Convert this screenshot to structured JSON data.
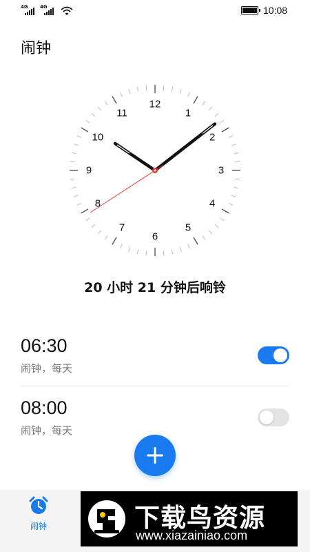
{
  "status_bar": {
    "network_1": "4G",
    "network_2": "4G",
    "time": "10:08",
    "icons": [
      "signal-icon",
      "signal-icon",
      "wifi-icon",
      "battery-icon"
    ]
  },
  "header": {
    "title": "闹钟"
  },
  "clock": {
    "numbers": [
      "12",
      "1",
      "2",
      "3",
      "4",
      "5",
      "6",
      "7",
      "8",
      "9",
      "10",
      "11"
    ],
    "hour": 10,
    "minute": 8,
    "second": 42,
    "hand_color": "#111111",
    "second_hand_color": "#e53935"
  },
  "countdown": "20 小时 21 分钟后响铃",
  "alarms": [
    {
      "time": "06:30",
      "label": "闹钟，每天",
      "enabled": true
    },
    {
      "time": "08:00",
      "label": "闹钟，每天",
      "enabled": false
    }
  ],
  "fab": {
    "icon": "plus-icon"
  },
  "bottom_nav": {
    "items": [
      {
        "label": "闹钟",
        "icon": "alarm-clock-icon",
        "active": true
      }
    ]
  },
  "watermark": {
    "title": "下载鸟资源",
    "url": "www.xiazainiao.com"
  },
  "colors": {
    "accent": "#1a7bf0",
    "toggle_off": "#e3e3e3",
    "text_secondary": "#777777"
  }
}
